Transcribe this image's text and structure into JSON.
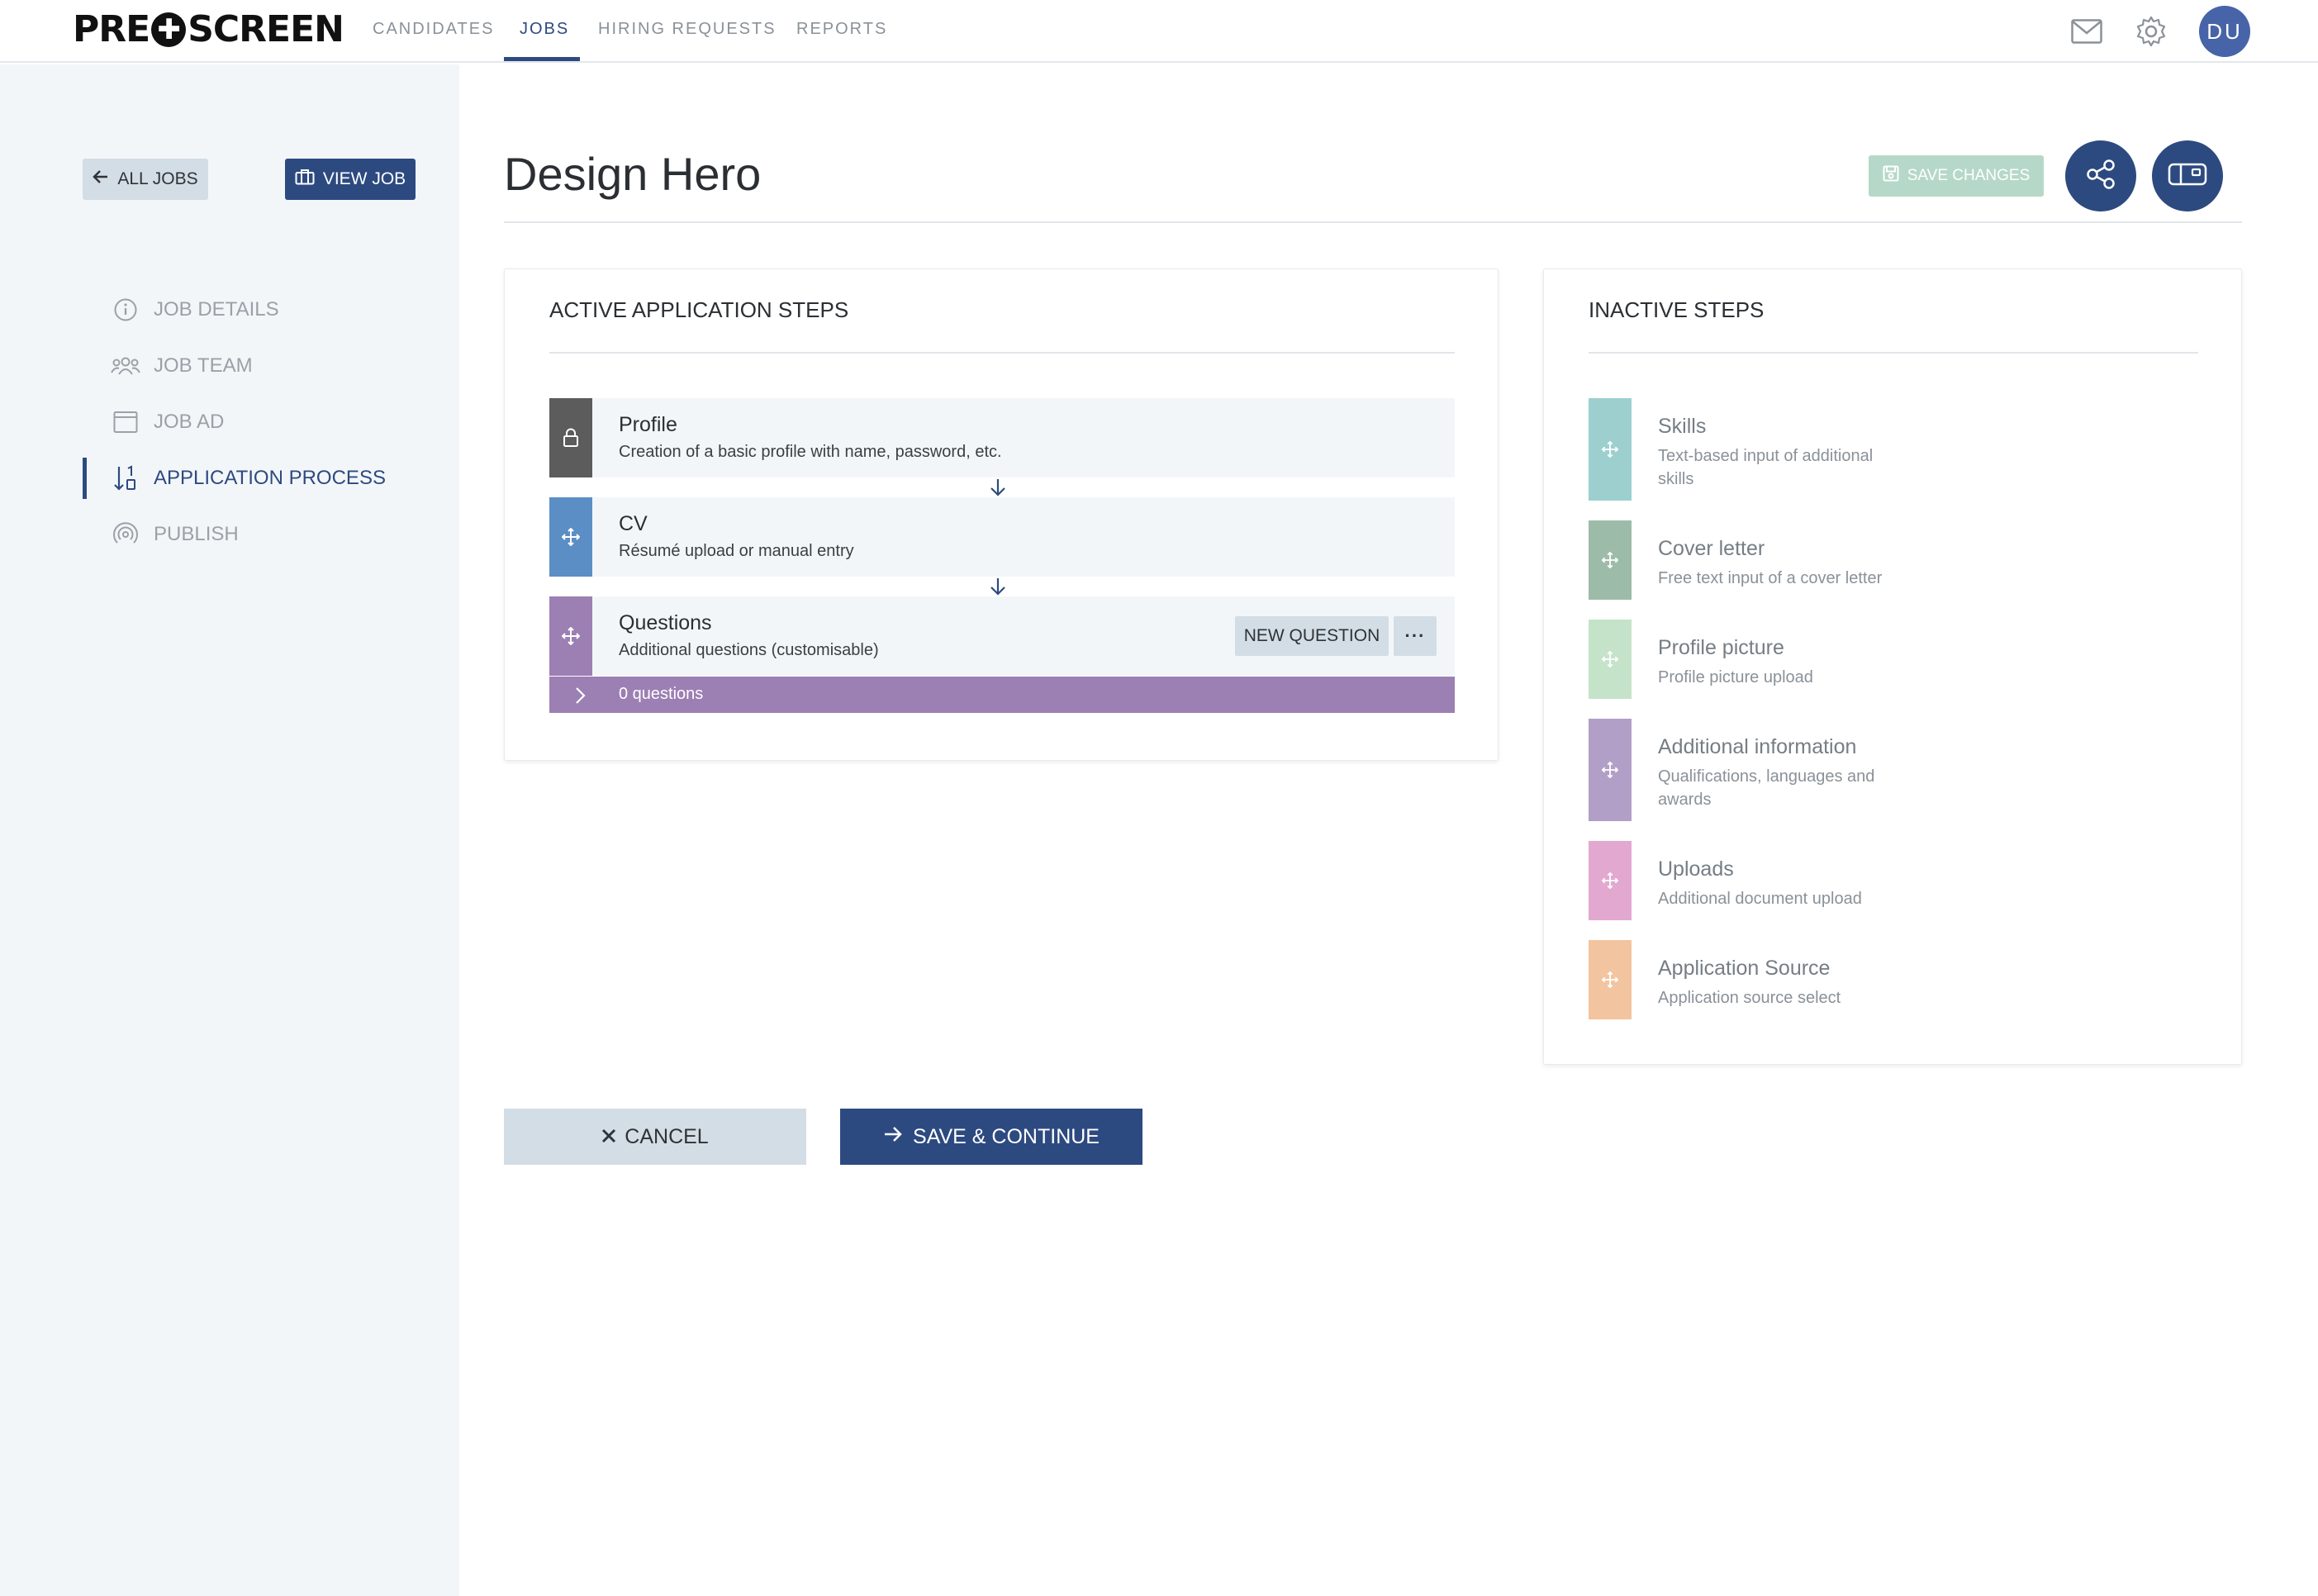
{
  "brand": {
    "logo_left": "PRE",
    "logo_cross": "✚",
    "logo_right": "SCREEN"
  },
  "nav": {
    "tabs": [
      {
        "label": "CANDIDATES",
        "active": false
      },
      {
        "label": "JOBS",
        "active": true
      },
      {
        "label": "HIRING REQUESTS",
        "active": false
      },
      {
        "label": "REPORTS",
        "active": false
      }
    ],
    "icons": [
      "mail-icon",
      "settings-gear-icon"
    ],
    "avatar_initials": "DU"
  },
  "sidebar": {
    "all_jobs_label": "ALL JOBS",
    "view_job_label": "VIEW JOB",
    "items": [
      {
        "label": "JOB DETAILS",
        "icon": "info-icon",
        "active": false
      },
      {
        "label": "JOB TEAM",
        "icon": "team-icon",
        "active": false
      },
      {
        "label": "JOB AD",
        "icon": "calendar-icon",
        "active": false
      },
      {
        "label": "APPLICATION PROCESS",
        "icon": "sort-icon",
        "active": true
      },
      {
        "label": "PUBLISH",
        "icon": "broadcast-icon",
        "active": false
      }
    ]
  },
  "header": {
    "title": "Design Hero",
    "save_changes_label": "SAVE CHANGES",
    "share_icon": "share-icon",
    "preview_icon": "preview-icon"
  },
  "active_steps": {
    "title": "ACTIVE APPLICATION STEPS",
    "steps": [
      {
        "name": "Profile",
        "desc": "Creation of a basic profile with name, password, etc.",
        "color": "#5c5c5c",
        "icon": "lock-icon"
      },
      {
        "name": "CV",
        "desc": "Résumé upload or manual entry",
        "color": "#5b8ec5",
        "icon": "move-icon"
      },
      {
        "name": "Questions",
        "desc": "Additional questions (customisable)",
        "color": "#9c7fb3",
        "icon": "move-icon"
      }
    ],
    "new_question_label": "NEW QUESTION",
    "more_label": "···",
    "questions_count_label": "0 questions"
  },
  "inactive_steps": {
    "title": "INACTIVE STEPS",
    "steps": [
      {
        "name": "Skills",
        "desc": "Text-based input of additional skills",
        "color": "#9dcfcf"
      },
      {
        "name": "Cover letter",
        "desc": "Free text input of a cover letter",
        "color": "#9dbba9"
      },
      {
        "name": "Profile picture",
        "desc": "Profile picture upload",
        "color": "#c5e3c9"
      },
      {
        "name": "Additional information",
        "desc": "Qualifications, languages and awards",
        "color": "#b19fc7"
      },
      {
        "name": "Uploads",
        "desc": "Additional document upload",
        "color": "#e2a8cf"
      },
      {
        "name": "Application Source",
        "desc": "Application source select",
        "color": "#f2c49f"
      }
    ]
  },
  "footer": {
    "cancel_label": "CANCEL",
    "save_continue_label": "SAVE & CONTINUE"
  }
}
